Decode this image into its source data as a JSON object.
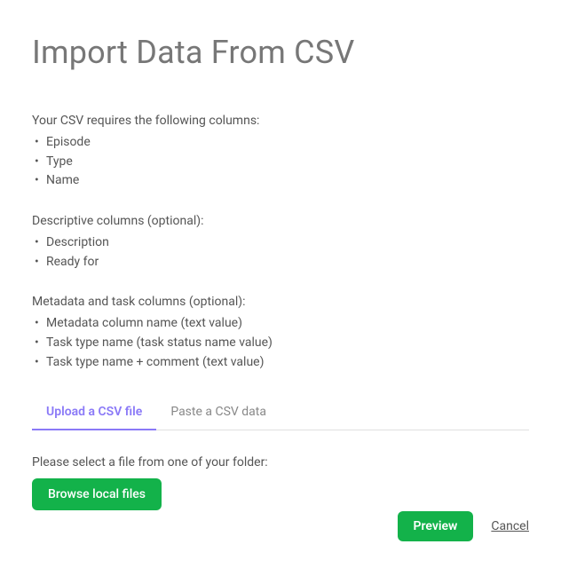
{
  "header": {
    "title": "Import Data From CSV"
  },
  "required": {
    "label": "Your CSV requires the following columns:",
    "items": [
      "Episode",
      "Type",
      "Name"
    ]
  },
  "descriptive": {
    "label": "Descriptive columns (optional):",
    "items": [
      "Description",
      "Ready for"
    ]
  },
  "meta_tasks": {
    "label": "Metadata and task columns (optional):",
    "items": [
      "Metadata column name (text value)",
      "Task type name (task status name value)",
      "Task type name + comment (text value)"
    ]
  },
  "tabs": {
    "upload": "Upload a CSV file",
    "paste": "Paste a CSV data"
  },
  "file_section": {
    "prompt": "Please select a file from one of your folder:",
    "browse_label": "Browse local files"
  },
  "footer": {
    "preview": "Preview",
    "cancel": "Cancel"
  }
}
